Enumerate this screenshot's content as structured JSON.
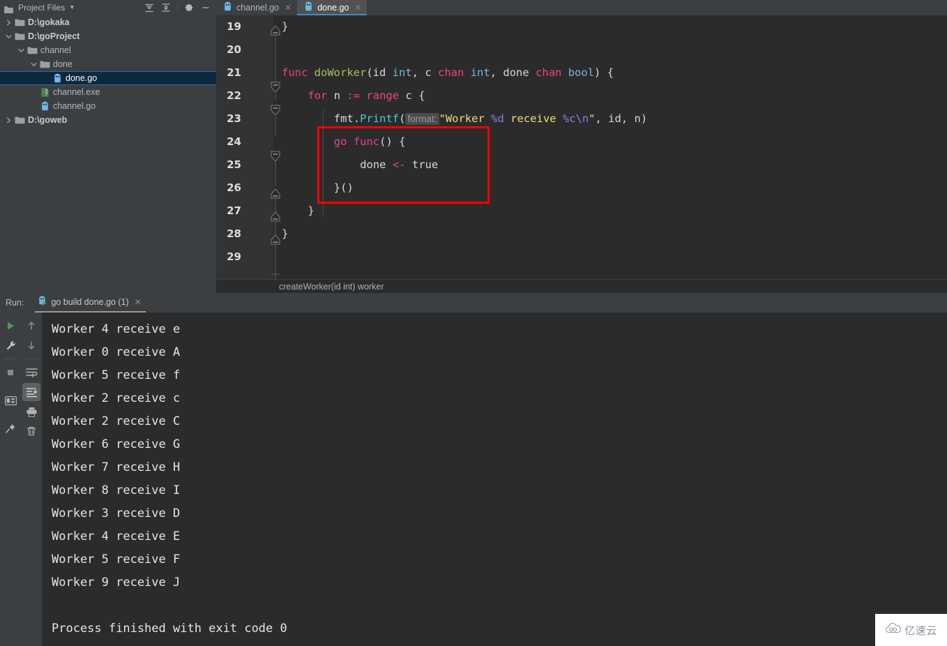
{
  "project_panel": {
    "title": "Project Files",
    "title_icon": "folder-icon",
    "dropdown_icon": "chevron-down-icon",
    "tools": [
      {
        "name": "expand-all-icon",
        "label": "Expand All"
      },
      {
        "name": "collapse-all-icon",
        "label": "Collapse All"
      },
      {
        "name": "gear-icon",
        "label": "Settings"
      },
      {
        "name": "hide-icon",
        "label": "Hide"
      }
    ],
    "tree": [
      {
        "label": "D:\\gokaka",
        "indent": 0,
        "arrow": "collapsed",
        "icon": "folder-icon",
        "style": "bold",
        "selected": false
      },
      {
        "label": "D:\\goProject",
        "indent": 0,
        "arrow": "expanded",
        "icon": "folder-icon",
        "style": "bold",
        "selected": false
      },
      {
        "label": "channel",
        "indent": 1,
        "arrow": "expanded",
        "icon": "folder-icon",
        "style": "normal",
        "selected": false
      },
      {
        "label": "done",
        "indent": 2,
        "arrow": "expanded",
        "icon": "folder-icon",
        "style": "normal",
        "selected": false
      },
      {
        "label": "done.go",
        "indent": 3,
        "arrow": "none",
        "icon": "go-file-icon",
        "style": "normal",
        "selected": true
      },
      {
        "label": "channel.exe",
        "indent": 2,
        "arrow": "none",
        "icon": "exe-file-icon",
        "style": "normal",
        "selected": false
      },
      {
        "label": "channel.go",
        "indent": 2,
        "arrow": "none",
        "icon": "go-file-icon",
        "style": "normal",
        "selected": false
      },
      {
        "label": "D:\\goweb",
        "indent": 0,
        "arrow": "collapsed",
        "icon": "folder-icon",
        "style": "bold",
        "selected": false
      }
    ]
  },
  "editor": {
    "tabs": [
      {
        "label": "channel.go",
        "icon": "go-file-icon",
        "active": false,
        "close_icon": "close-icon"
      },
      {
        "label": "done.go",
        "icon": "go-file-icon",
        "active": true,
        "close_icon": "close-icon"
      }
    ],
    "line_numbers": [
      "19",
      "20",
      "21",
      "22",
      "23",
      "24",
      "25",
      "26",
      "27",
      "28",
      "29"
    ],
    "code_lines": [
      {
        "num": "19",
        "tokens": [
          {
            "t": "}",
            "c": "plain"
          }
        ],
        "indent": 0
      },
      {
        "num": "20",
        "tokens": [],
        "indent": 0
      },
      {
        "num": "21",
        "tokens": [
          {
            "t": "func",
            "c": "kw"
          },
          {
            "t": " ",
            "c": "plain"
          },
          {
            "t": "doWorker",
            "c": "fn"
          },
          {
            "t": "(",
            "c": "punc"
          },
          {
            "t": "id ",
            "c": "plain"
          },
          {
            "t": "int",
            "c": "type"
          },
          {
            "t": ", ",
            "c": "punc"
          },
          {
            "t": "c ",
            "c": "plain"
          },
          {
            "t": "chan",
            "c": "kw"
          },
          {
            "t": " ",
            "c": "plain"
          },
          {
            "t": "int",
            "c": "type"
          },
          {
            "t": ", ",
            "c": "punc"
          },
          {
            "t": "done ",
            "c": "plain"
          },
          {
            "t": "chan",
            "c": "kw"
          },
          {
            "t": " ",
            "c": "plain"
          },
          {
            "t": "bool",
            "c": "type"
          },
          {
            "t": ") {",
            "c": "punc"
          }
        ],
        "indent": 0
      },
      {
        "num": "22",
        "tokens": [
          {
            "t": "for",
            "c": "kw"
          },
          {
            "t": " n ",
            "c": "plain"
          },
          {
            "t": ":=",
            "c": "kw"
          },
          {
            "t": " ",
            "c": "plain"
          },
          {
            "t": "range",
            "c": "kw"
          },
          {
            "t": " c {",
            "c": "plain"
          }
        ],
        "indent": 1
      },
      {
        "num": "23",
        "tokens": [
          {
            "t": "fmt",
            "c": "plain"
          },
          {
            "t": ".",
            "c": "punc"
          },
          {
            "t": "Printf",
            "c": "call"
          },
          {
            "t": "(",
            "c": "punc"
          },
          {
            "t": "format:",
            "c": "hint"
          },
          {
            "t": "\"Worker ",
            "c": "str"
          },
          {
            "t": "%d",
            "c": "fmt"
          },
          {
            "t": " receive ",
            "c": "str"
          },
          {
            "t": "%c\\n",
            "c": "fmt"
          },
          {
            "t": "\"",
            "c": "str"
          },
          {
            "t": ", id, n)",
            "c": "plain"
          }
        ],
        "indent": 2
      },
      {
        "num": "24",
        "tokens": [
          {
            "t": "go",
            "c": "kw"
          },
          {
            "t": " ",
            "c": "plain"
          },
          {
            "t": "func",
            "c": "kw"
          },
          {
            "t": "() {",
            "c": "punc"
          }
        ],
        "indent": 2
      },
      {
        "num": "25",
        "tokens": [
          {
            "t": "done ",
            "c": "plain"
          },
          {
            "t": "<-",
            "c": "kw"
          },
          {
            "t": " true",
            "c": "plain"
          }
        ],
        "indent": 3
      },
      {
        "num": "26",
        "tokens": [
          {
            "t": "}()",
            "c": "plain"
          }
        ],
        "indent": 2
      },
      {
        "num": "27",
        "tokens": [
          {
            "t": "}",
            "c": "plain"
          }
        ],
        "indent": 1
      },
      {
        "num": "28",
        "tokens": [
          {
            "t": "}",
            "c": "plain"
          }
        ],
        "indent": 0
      },
      {
        "num": "29",
        "tokens": [],
        "indent": 0
      }
    ],
    "highlight_box_color": "#ff0000",
    "breadcrumb": "createWorker(id int) worker"
  },
  "run_panel": {
    "label": "Run:",
    "tab": {
      "label": "go build done.go (1)",
      "icon": "go-run-icon",
      "close_icon": "close-icon"
    },
    "left_tools": [
      {
        "name": "rerun-play-icon"
      },
      {
        "name": "wrench-settings-icon"
      },
      {
        "name": "stop-icon"
      },
      {
        "name": "console-layout-icon"
      },
      {
        "name": "pin-icon"
      }
    ],
    "right_tools": [
      {
        "name": "arrow-up-icon"
      },
      {
        "name": "arrow-down-icon"
      },
      {
        "name": "soft-wrap-icon"
      },
      {
        "name": "scroll-to-end-icon"
      },
      {
        "name": "print-icon"
      },
      {
        "name": "trash-icon"
      }
    ],
    "console_output": [
      "Worker 4 receive e",
      "Worker 0 receive A",
      "Worker 5 receive f",
      "Worker 2 receive c",
      "Worker 2 receive C",
      "Worker 6 receive G",
      "Worker 7 receive H",
      "Worker 8 receive I",
      "Worker 3 receive D",
      "Worker 4 receive E",
      "Worker 5 receive F",
      "Worker 9 receive J",
      "",
      "Process finished with exit code 0"
    ]
  },
  "watermark": {
    "text": "亿速云",
    "icon": "cloud-logo-icon"
  },
  "colors": {
    "panel_bg": "#3c3f41",
    "editor_bg": "#2b2b2b",
    "gutter_bg": "#313335",
    "selection_bg": "#0d293e",
    "selection_border": "#2d6ca2",
    "tab_active_underline": "#4a88c7",
    "keyword": "#e8477f",
    "function": "#a5c261",
    "type": "#7fb3d5",
    "call": "#4ec9d8",
    "string": "#e8e07a",
    "format_spec": "#9876ec",
    "highlight": "#ff0000"
  }
}
